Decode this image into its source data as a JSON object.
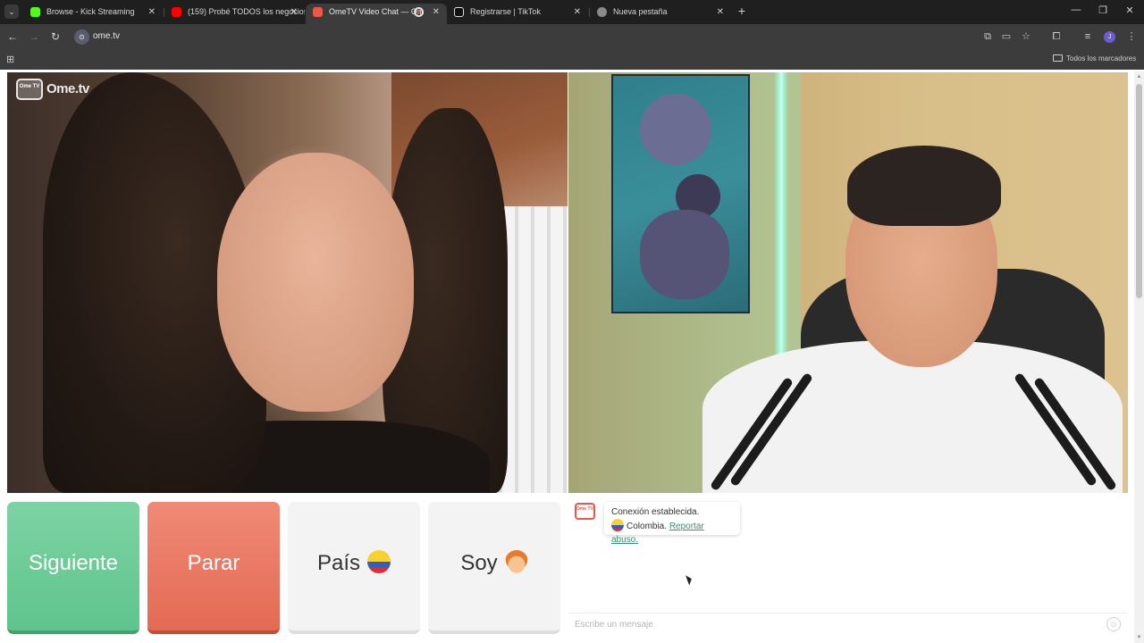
{
  "browser": {
    "tabs": [
      {
        "title": "Browse - Kick Streaming",
        "icon": "kick-icon",
        "color": "#53fc18"
      },
      {
        "title": "(159) Probé TODOS los negocios",
        "icon": "youtube-icon",
        "color": "#ff0000"
      },
      {
        "title": "OmeTV Video Chat — Om",
        "icon": "ometv-icon",
        "color": "#e9584a",
        "active": true,
        "recording": true
      },
      {
        "title": "Registrarse | TikTok",
        "icon": "tiktok-icon",
        "color": "#ffffff"
      },
      {
        "title": "Nueva pestaña",
        "icon": "chrome-icon",
        "color": "#cfcfcf"
      }
    ],
    "url": "ome.tv",
    "bookmarks_all": "Todos los marcadores",
    "profile_initial": "J"
  },
  "logo": {
    "badge": "Ome TV",
    "text": "Ome.tv"
  },
  "controls": {
    "next_label": "Siguiente",
    "stop_label": "Parar",
    "country_label": "País",
    "gender_label": "Soy"
  },
  "chat": {
    "avatar_text": "Ome TV",
    "status": "Conexión establecida.",
    "country": "Colombia.",
    "report_link": "Reportar abuso.",
    "input_placeholder": "Escribe un mensaje"
  },
  "colors": {
    "next": "#5fc48d",
    "stop": "#e46a55",
    "brand": "#e9584a",
    "link": "#3a8f6d"
  }
}
